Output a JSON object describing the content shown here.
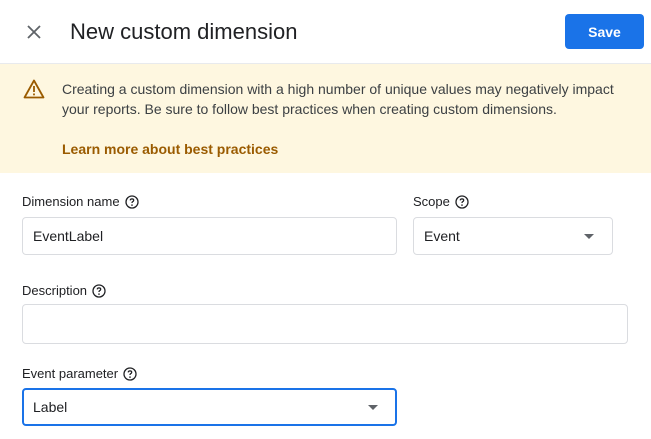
{
  "header": {
    "title": "New custom dimension",
    "save_label": "Save",
    "close_icon": "close-icon"
  },
  "warning": {
    "icon": "warning-icon",
    "text": "Creating a custom dimension with a high number of unique values may negatively impact your reports. Be sure to follow best practices when creating custom dimensions.",
    "link_label": "Learn more about best practices",
    "background": "#fef7e0",
    "link_color": "#9a5b00"
  },
  "form": {
    "dimension_name": {
      "label": "Dimension name",
      "value": "EventLabel"
    },
    "scope": {
      "label": "Scope",
      "value": "Event"
    },
    "description": {
      "label": "Description",
      "value": ""
    },
    "event_parameter": {
      "label": "Event parameter",
      "value": "Label"
    }
  },
  "colors": {
    "accent": "#1a73e8"
  }
}
